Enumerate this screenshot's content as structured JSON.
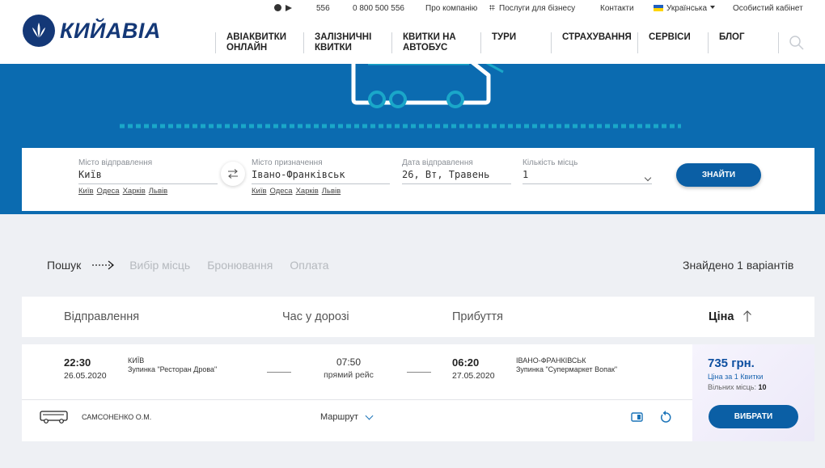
{
  "topbar": {
    "phone_short": "556",
    "phone_free": "0 800 500 556",
    "about": "Про компанію",
    "business": "Послуги для бізнесу",
    "contacts": "Контакти",
    "language": "Українська",
    "cabinet": "Особистий кабінет"
  },
  "logo": {
    "text": "КИЙАВІА"
  },
  "nav": [
    {
      "line1": "АВІАКВИТКИ",
      "line2": "ОНЛАЙН"
    },
    {
      "line1": "ЗАЛІЗНИЧНІ",
      "line2": "КВИТКИ"
    },
    {
      "line1": "КВИТКИ НА",
      "line2": "АВТОБУС"
    },
    {
      "line1": "ТУРИ",
      "line2": ""
    },
    {
      "line1": "СТРАХУВАННЯ",
      "line2": ""
    },
    {
      "line1": "СЕРВІСИ",
      "line2": ""
    },
    {
      "line1": "БЛОГ",
      "line2": ""
    }
  ],
  "search": {
    "from_label": "Місто відправлення",
    "from_value": "Київ",
    "from_quick": [
      "Київ",
      "Одеса",
      "Харків",
      "Львів"
    ],
    "to_label": "Місто призначення",
    "to_value": "Івано-Франківськ",
    "to_quick": [
      "Київ",
      "Одеса",
      "Харків",
      "Львів"
    ],
    "date_label": "Дата відправлення",
    "date_value": "26, Вт, Травень",
    "seats_label": "Кількість місць",
    "seats_value": "1",
    "find_button": "ЗНАЙТИ"
  },
  "steps": {
    "active": "Пошук",
    "inactive": [
      "Вибір місць",
      "Бронювання",
      "Оплата"
    ],
    "found": "Знайдено 1 варіантів"
  },
  "table_header": {
    "departure": "Відправлення",
    "duration": "Час у дорозі",
    "arrival": "Прибуття",
    "price": "Ціна"
  },
  "trip": {
    "dep_time": "22:30",
    "dep_date": "26.05.2020",
    "dep_city": "Київ",
    "dep_stop": "Зупинка \"Ресторан Дрова\"",
    "duration": "07:50",
    "trip_type": "прямий рейс",
    "arr_time": "06:20",
    "arr_date": "27.05.2020",
    "arr_city": "Івано-Франківськ",
    "arr_stop": "Зупинка \"Супермаркет Вопак\"",
    "carrier": "САМСОНЕНКО О.М.",
    "route_label": "Маршрут",
    "price": "735 грн.",
    "price_note": "Ціна за 1 Квитки",
    "free_seats_label": "Вільних місць:",
    "free_seats": "10",
    "choose_button": "ВИБРАТИ"
  },
  "colors": {
    "brand_blue": "#0b6bb0",
    "button_blue": "#0b5fa5",
    "logo_navy": "#143877",
    "accent_teal": "#1aa7c9"
  }
}
